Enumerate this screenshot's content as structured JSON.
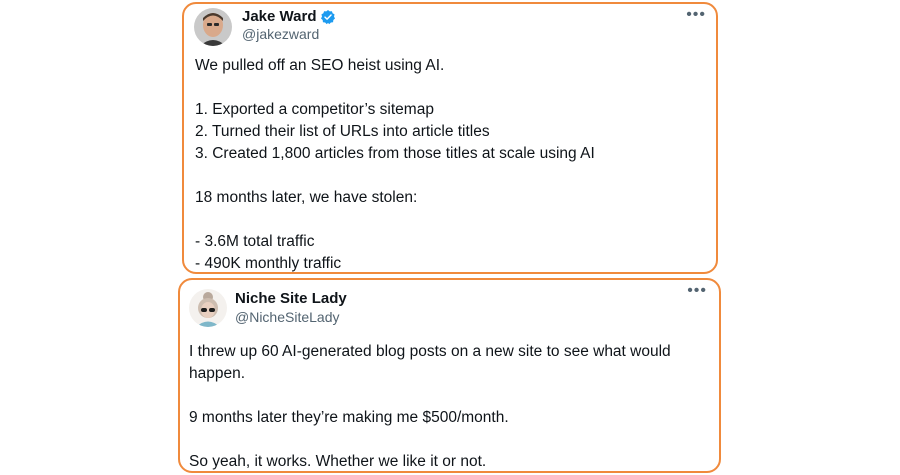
{
  "tweets": [
    {
      "author_name": "Jake Ward",
      "verified": true,
      "handle": "@jakezward",
      "more_icon": "more-horizontal-icon",
      "lines": [
        "We pulled off an SEO heist using AI.",
        "1. Exported a competitor’s sitemap",
        "2. Turned their list of URLs into article titles",
        "3. Created 1,800 articles from those titles at scale using AI",
        "18 months later, we have stolen:",
        "- 3.6M total traffic",
        "- 490K monthly traffic"
      ]
    },
    {
      "author_name": "Niche Site Lady",
      "verified": false,
      "handle": "@NicheSiteLady",
      "more_icon": "more-horizontal-icon",
      "lines": [
        "I threw up 60 AI-generated blog posts on a new site to see what would happen.",
        "9 months later they’re making me $500/month.",
        "So yeah, it works. Whether we like it or not."
      ]
    }
  ],
  "colors": {
    "highlight_border": "#f08a3c",
    "verified_blue": "#1d9bf0",
    "secondary_text": "#536471",
    "primary_text": "#0f1419"
  }
}
